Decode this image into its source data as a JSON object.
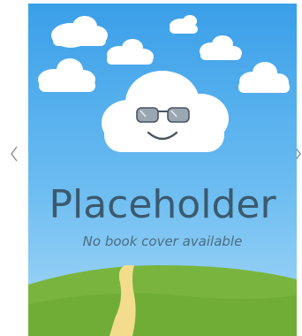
{
  "navigation": {
    "prev_icon": "chevron-left-icon",
    "next_icon": "chevron-right-icon"
  },
  "cover": {
    "title": "Placeholder",
    "subtitle": "No book cover available",
    "colors": {
      "sky_top": "#3a9fe8",
      "sky_bottom": "#8ecdf5",
      "cloud": "#ffffff",
      "hill": "#79b43e",
      "hill_dark": "#5d9a2c",
      "path": "#f3dd8c",
      "text": "#3b5a6e"
    }
  }
}
